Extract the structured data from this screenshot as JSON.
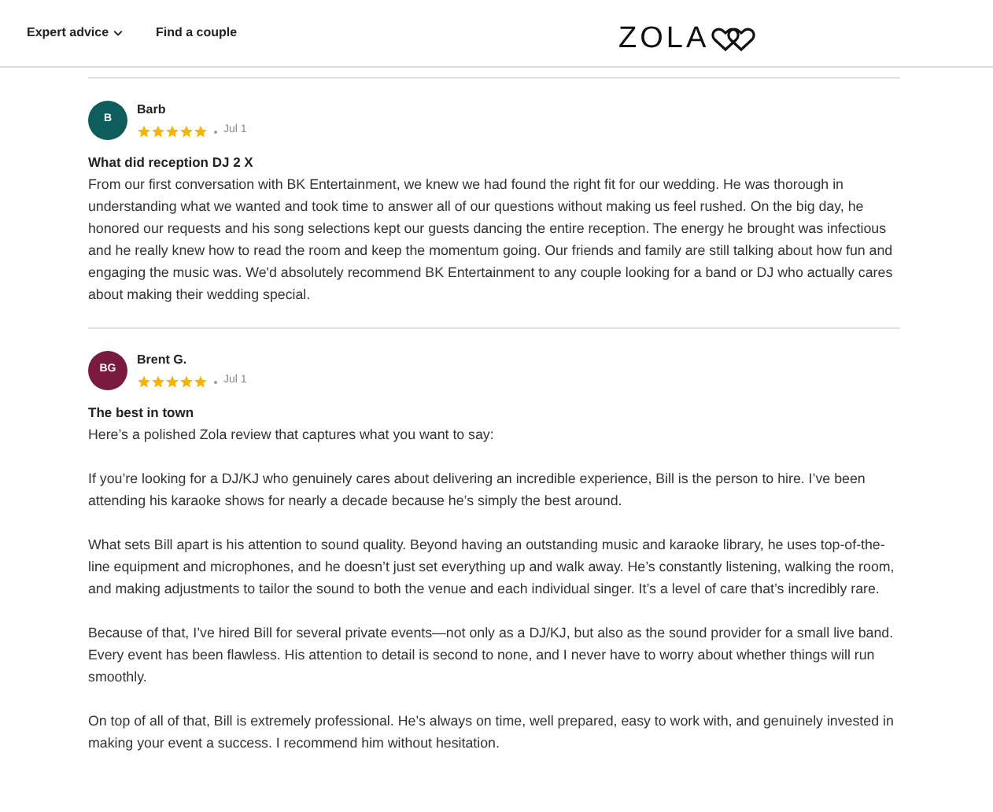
{
  "nav": [
    {
      "label": "Expert advice",
      "kind": "dropdown"
    },
    {
      "label": "Find a couple",
      "kind": "link"
    }
  ],
  "logo": {
    "text": "ZOLA"
  },
  "reviews": [
    {
      "initials": "B",
      "color": "#0f5c5c",
      "name": "Barb",
      "stars": 5,
      "date": "Jul 1",
      "title": "What did reception DJ 2 X",
      "paragraphs": [
        "From our first conversation with BK Entertainment, we knew we had found the right fit for our wedding. He was thorough in understanding what we wanted and took time to answer all of our questions without making us feel rushed. On the big day, he honored our requests and his song selections kept our guests dancing the entire reception. The energy he brought was infectious and he really knew how to read the room and keep the momentum going. Our friends and family are still talking about how fun and engaging the music was. We'd absolutely recommend BK Entertainment to any couple looking for a band or DJ who actually cares about making their wedding special."
      ]
    },
    {
      "initials": "BG",
      "color": "#7a1a3e",
      "name": "Brent G.",
      "stars": 5,
      "date": "Jul 1",
      "title": "The best in town",
      "paragraphs": [
        "Here’s a polished Zola review that captures what you want to say:",
        "If you’re looking for a DJ/KJ who genuinely cares about delivering an incredible experience, Bill is the person to hire. I’ve been attending his karaoke shows for nearly a decade because he’s simply the best around.",
        "What sets Bill apart is his attention to sound quality. Beyond having an outstanding music and karaoke library, he uses top-of-the-line equipment and microphones, and he doesn’t just set everything up and walk away. He’s constantly listening, walking the room, and making adjustments to tailor the sound to both the venue and each individual singer. It’s a level of care that’s incredibly rare.",
        "Because of that, I’ve hired Bill for several private events—not only as a DJ/KJ, but also as the sound provider for a small live band. Every event has been flawless. His attention to detail is second to none, and I never have to worry about whether things will run smoothly.",
        "On top of all of that, Bill is extremely professional. He’s always on time, well prepared, easy to work with, and genuinely invested in making your event a success. I recommend him without hesitation."
      ]
    }
  ]
}
